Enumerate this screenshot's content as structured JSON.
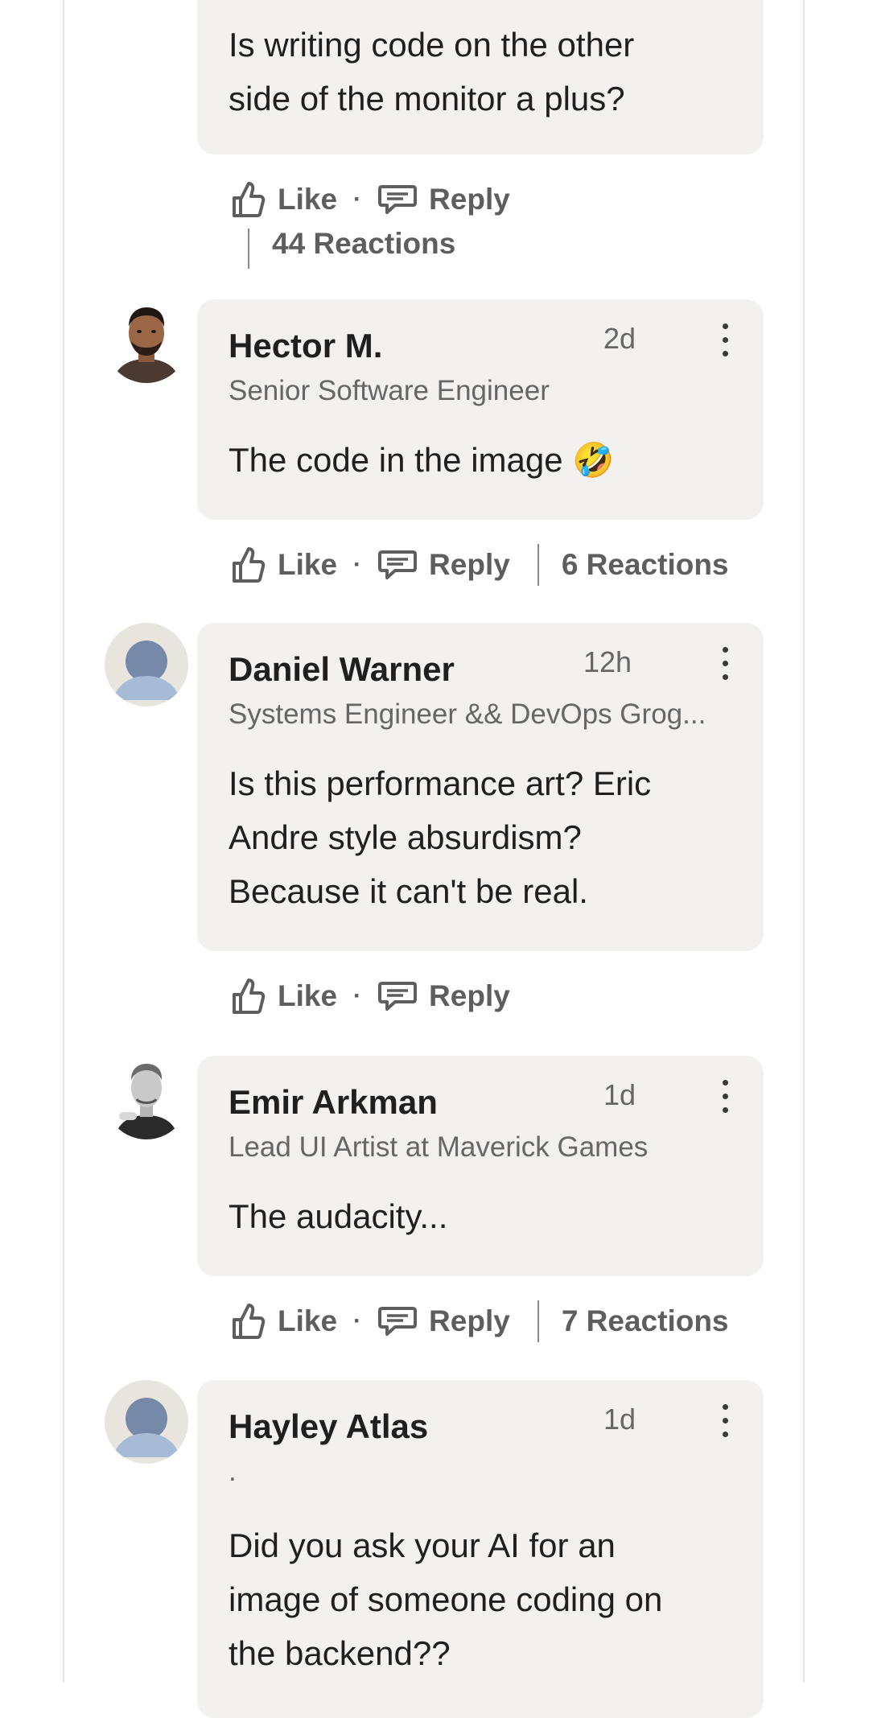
{
  "comments": [
    {
      "id": "c0",
      "body": [
        "Is writing code on the other",
        "side of the monitor a plus?"
      ],
      "like_label": "Like",
      "reply_label": "Reply",
      "reactions": "44 Reactions"
    },
    {
      "id": "c1",
      "author": "Hector M.",
      "headline": "Senior Software Engineer",
      "time": "2d",
      "body": [
        "The code in the image 🤣"
      ],
      "like_label": "Like",
      "reply_label": "Reply",
      "reactions": "6 Reactions",
      "avatar": "photo-man-beard"
    },
    {
      "id": "c2",
      "author": "Daniel Warner",
      "headline": "Systems Engineer && DevOps Grog...",
      "time": "12h",
      "body": [
        "Is this performance art? Eric",
        "Andre style absurdism?",
        "Because it can't be real."
      ],
      "like_label": "Like",
      "reply_label": "Reply",
      "avatar": "default-person-icon"
    },
    {
      "id": "c3",
      "author": "Emir Arkman",
      "headline": "Lead UI Artist at Maverick Games",
      "time": "1d",
      "body": [
        "The audacity..."
      ],
      "like_label": "Like",
      "reply_label": "Reply",
      "reactions": "7 Reactions",
      "avatar": "photo-man-bw"
    },
    {
      "id": "c4",
      "author": "Hayley Atlas",
      "headline": ".",
      "time": "1d",
      "body": [
        "Did you ask your AI for an",
        "image of someone coding on",
        "the backend??"
      ],
      "avatar": "default-person-icon"
    }
  ],
  "icons": {
    "like": "thumbs-up-outline-icon",
    "reply": "speech-bubble-icon",
    "more": "vertical-dots-icon"
  },
  "colors": {
    "bubble": "#f2f1f0",
    "text": "#1f1f1f",
    "muted": "#666666",
    "action": "#5e5e5e"
  }
}
